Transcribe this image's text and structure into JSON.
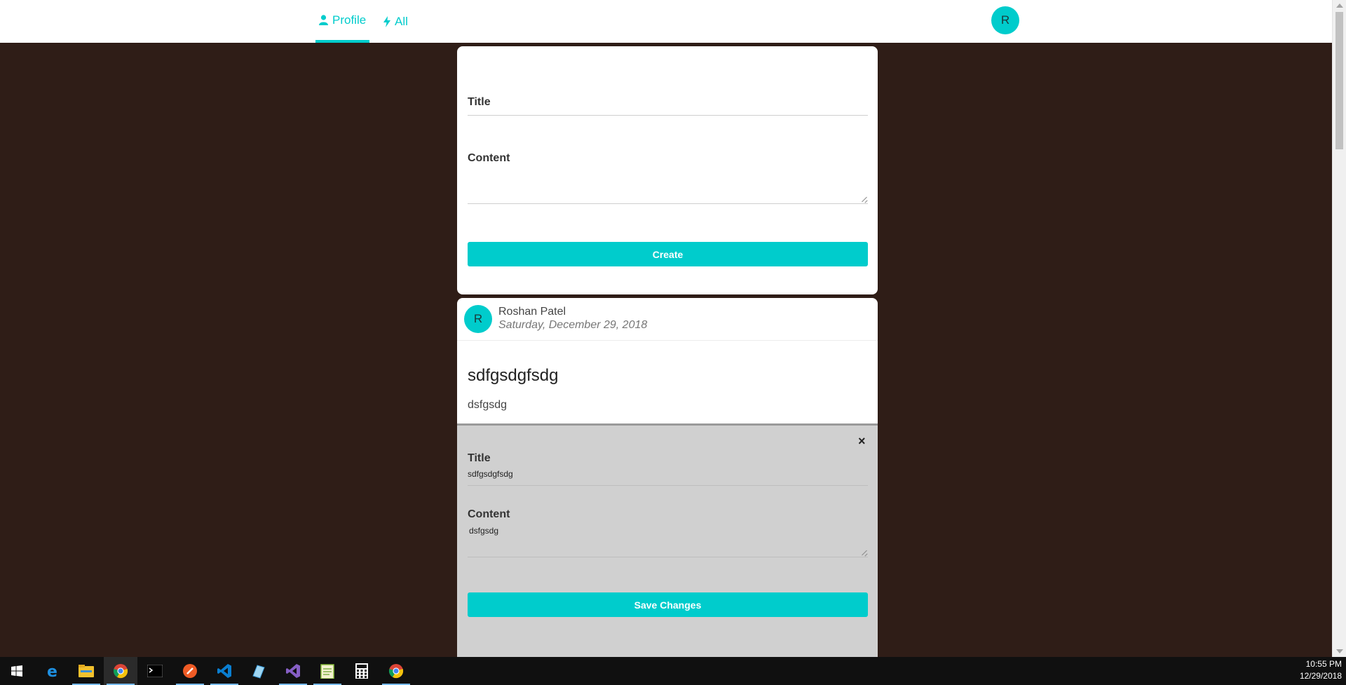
{
  "nav": {
    "tabs": [
      {
        "label": "Profile",
        "icon": "user-icon"
      },
      {
        "label": "All",
        "icon": "bolt-icon"
      }
    ],
    "avatar_initial": "R",
    "accent": "#00cccc"
  },
  "create_form": {
    "title_label": "Title",
    "content_label": "Content",
    "submit_label": "Create"
  },
  "post": {
    "avatar_initial": "R",
    "author": "Roshan Patel",
    "date": "Saturday, December 29, 2018",
    "title": "sdfgsdgfsdg",
    "content": "dsfgsdg"
  },
  "edit_form": {
    "close_label": "×",
    "title_label": "Title",
    "title_value": "sdfgsdgfsdg",
    "content_label": "Content",
    "content_value": "dsfgsdg",
    "submit_label": "Save Changes"
  },
  "taskbar": {
    "apps": [
      "start-icon",
      "edge-icon",
      "file-explorer-icon",
      "chrome-icon",
      "terminal-icon",
      "postman-icon",
      "vscode-icon",
      "paint-icon",
      "visual-studio-icon",
      "notepad-icon",
      "calculator-icon",
      "chrome-icon"
    ],
    "time": "10:55 PM",
    "date": "12/29/2018"
  },
  "colors": {
    "background": "#2f1d17",
    "accent": "#00cccc",
    "edit_panel": "#d0d0d0"
  }
}
